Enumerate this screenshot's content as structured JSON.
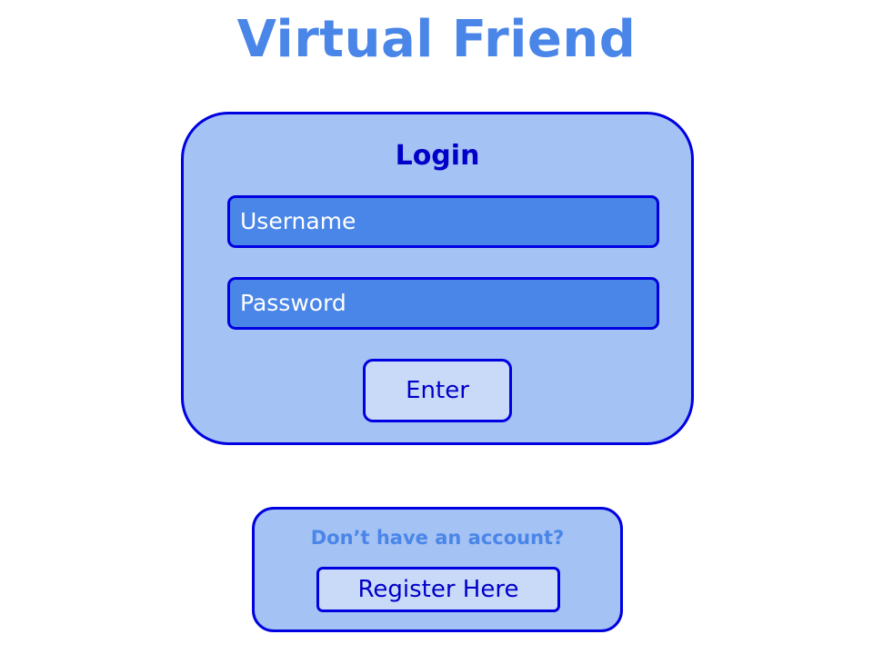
{
  "app": {
    "title": "Virtual Friend"
  },
  "login": {
    "heading": "Login",
    "username_placeholder": "Username",
    "password_placeholder": "Password",
    "enter_label": "Enter"
  },
  "register": {
    "prompt": "Don’t have an account?",
    "button_label": "Register Here"
  },
  "colors": {
    "accent": "#4a86e8",
    "card_background": "#a4c2f4",
    "border": "#0000e0",
    "button_background": "#c9daf8",
    "dark_text": "#0000c8"
  }
}
